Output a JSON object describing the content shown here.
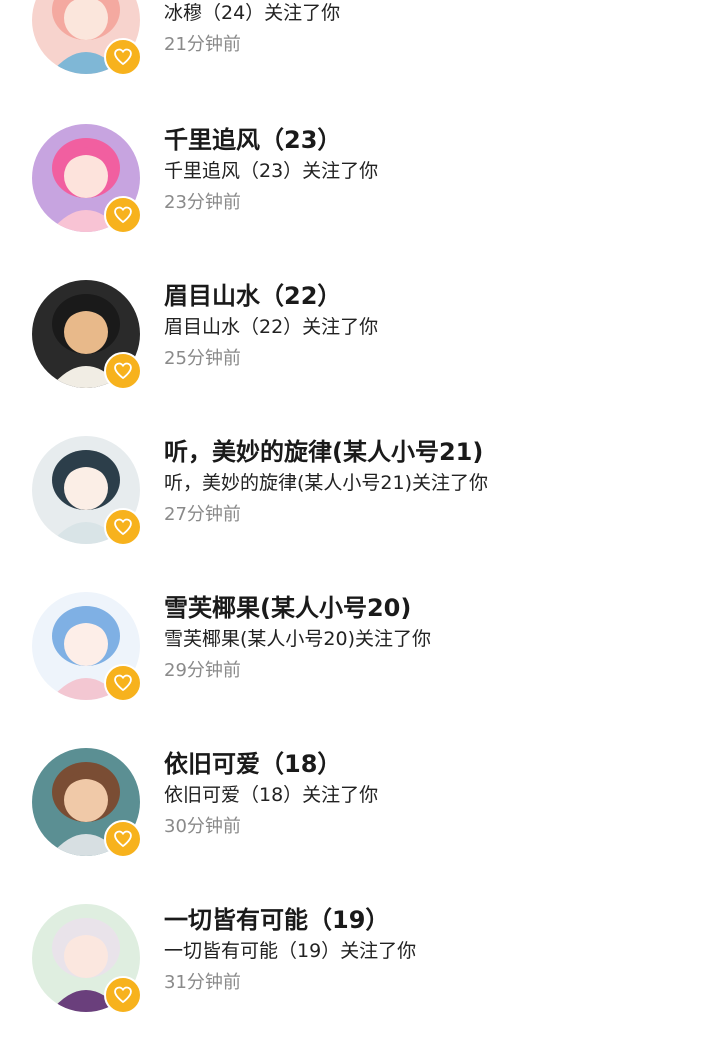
{
  "accent_color": "#f7b21d",
  "badge_icon": "heart-icon",
  "notifications": [
    {
      "name": "",
      "action": "冰穆（24）关注了你",
      "time": "21分钟前",
      "avatar": {
        "bg": "#f7d3cd",
        "hair": "#f4a9a0",
        "skin": "#fbe6dc",
        "cloth": "#7fb7d6"
      }
    },
    {
      "name": "千里追风（23）",
      "action": "千里追风（23）关注了你",
      "time": "23分钟前",
      "avatar": {
        "bg": "#c7a4e0",
        "hair": "#f15fa0",
        "skin": "#fde3dc",
        "cloth": "#f8c3d4"
      }
    },
    {
      "name": "眉目山水（22）",
      "action": "眉目山水（22）关注了你",
      "time": "25分钟前",
      "avatar": {
        "bg": "#2a2a2a",
        "hair": "#1a1a1a",
        "skin": "#e8b98a",
        "cloth": "#f1ede4"
      }
    },
    {
      "name": "听，美妙的旋律(某人小号21)",
      "action": "听，美妙的旋律(某人小号21)关注了你",
      "time": "27分钟前",
      "avatar": {
        "bg": "#e7ecee",
        "hair": "#2c3e4a",
        "skin": "#fbeee6",
        "cloth": "#d9e4e7"
      }
    },
    {
      "name": "雪芙椰果(某人小号20)",
      "action": "雪芙椰果(某人小号20)关注了你",
      "time": "29分钟前",
      "avatar": {
        "bg": "#eef4fb",
        "hair": "#7fb0e4",
        "skin": "#fdeee8",
        "cloth": "#f3c7d2"
      }
    },
    {
      "name": "依旧可爱（18）",
      "action": "依旧可爱（18）关注了你",
      "time": "30分钟前",
      "avatar": {
        "bg": "#5b8f93",
        "hair": "#7a4d34",
        "skin": "#f0c9a8",
        "cloth": "#d7dfe2"
      }
    },
    {
      "name": "一切皆有可能（19）",
      "action": "一切皆有可能（19）关注了你",
      "time": "31分钟前",
      "avatar": {
        "bg": "#dfeee0",
        "hair": "#e9e3ea",
        "skin": "#fbe7df",
        "cloth": "#6a3f7c"
      }
    }
  ]
}
